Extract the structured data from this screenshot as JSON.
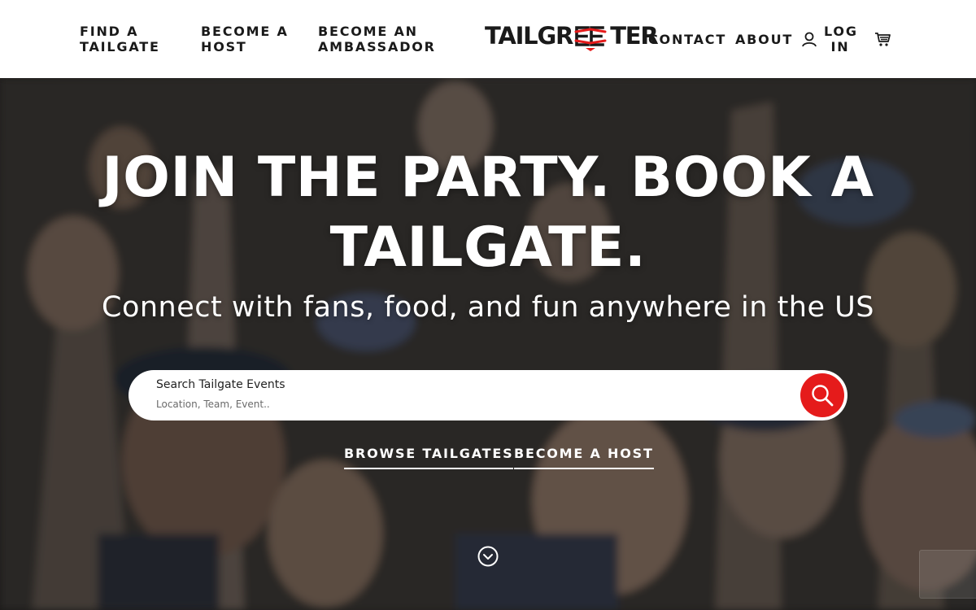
{
  "nav": {
    "find_tailgate": "FIND A TAILGATE",
    "become_host": "BECOME A HOST",
    "become_ambassador": "BECOME AN AMBASSADOR",
    "contact": "CONTACT",
    "about": "ABOUT",
    "login": "LOG IN"
  },
  "logo": {
    "prefix": "TAILGR",
    "suffix": "TER",
    "full_text": "TAILGREETER",
    "accent_color": "#e51b1b"
  },
  "hero": {
    "title": "JOIN THE PARTY. BOOK A TAILGATE.",
    "subtitle": "Connect with fans, food, and fun anywhere in the US"
  },
  "search": {
    "label": "Search Tailgate Events",
    "placeholder": "Location, Team, Event..",
    "button_color": "#e51b1b"
  },
  "cta": {
    "browse": "BROWSE TAILGATES",
    "host": "BECOME A HOST"
  },
  "icons": {
    "user": "user-icon",
    "cart": "cart-icon",
    "search": "search-icon",
    "scroll_down": "chevron-down-circle-icon"
  }
}
